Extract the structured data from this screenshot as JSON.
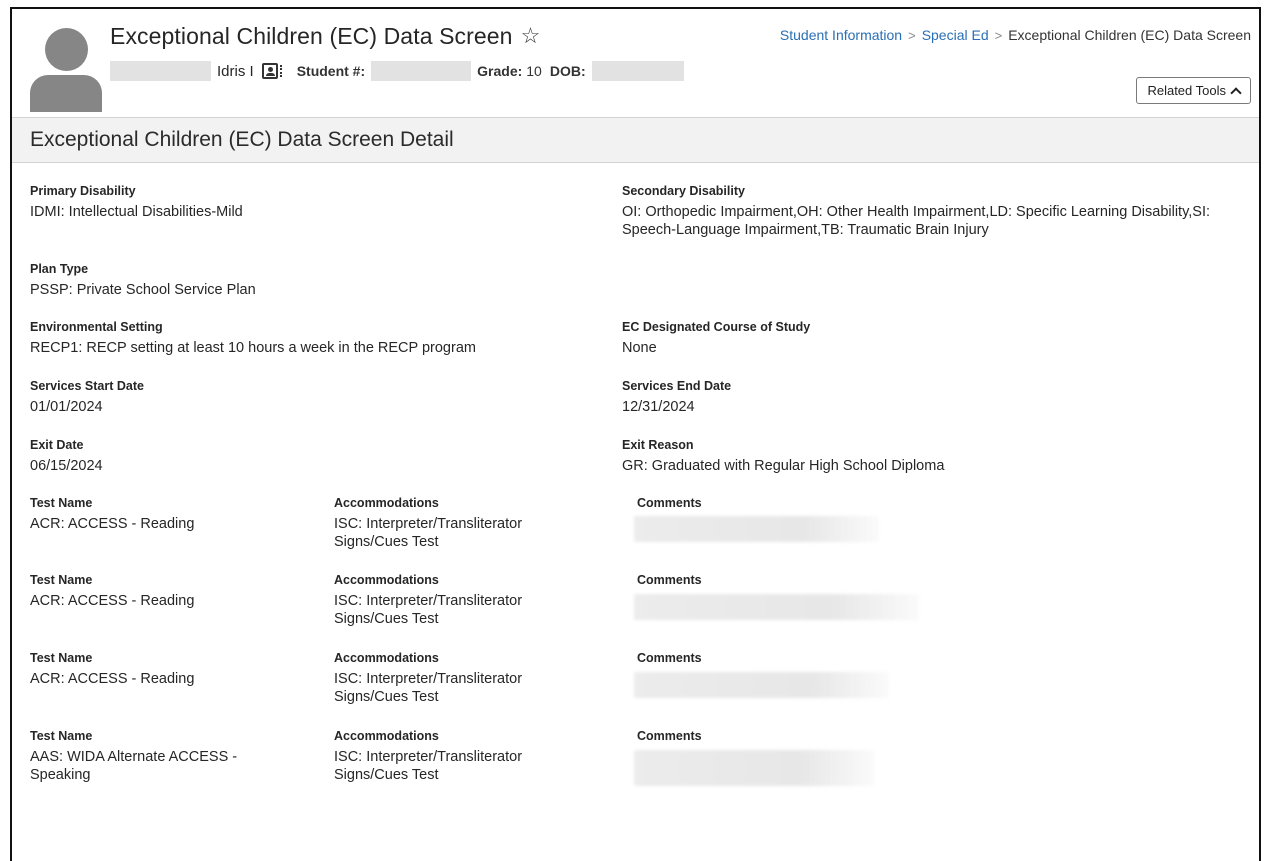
{
  "header": {
    "page_title": "Exceptional Children (EC) Data Screen",
    "student_name": "Idris I",
    "student_num_label": "Student #:",
    "grade_label": "Grade:",
    "grade_value": "10",
    "dob_label": "DOB:"
  },
  "breadcrumb": {
    "items": [
      "Student Information",
      "Special Ed",
      "Exceptional Children (EC) Data Screen"
    ],
    "separator": ">"
  },
  "related_tools": {
    "label": "Related Tools"
  },
  "detail": {
    "title": "Exceptional Children (EC) Data Screen Detail",
    "primary_disability": {
      "label": "Primary Disability",
      "value": "IDMI: Intellectual Disabilities-Mild"
    },
    "secondary_disability": {
      "label": "Secondary Disability",
      "value": "OI: Orthopedic Impairment,OH: Other Health Impairment,LD: Specific Learning Disability,SI: Speech-Language Impairment,TB: Traumatic Brain Injury"
    },
    "plan_type": {
      "label": "Plan Type",
      "value": "PSSP: Private School Service Plan"
    },
    "environmental_setting": {
      "label": "Environmental Setting",
      "value": "RECP1: RECP setting at least 10 hours a week in the RECP program"
    },
    "course_of_study": {
      "label": "EC Designated Course of Study",
      "value": "None"
    },
    "services_start": {
      "label": "Services Start Date",
      "value": "01/01/2024"
    },
    "services_end": {
      "label": "Services End Date",
      "value": "12/31/2024"
    },
    "exit_date": {
      "label": "Exit Date",
      "value": "06/15/2024"
    },
    "exit_reason": {
      "label": "Exit Reason",
      "value": "GR: Graduated with Regular High School Diploma"
    }
  },
  "tests": {
    "test_name_label": "Test Name",
    "accommodations_label": "Accommodations",
    "comments_label": "Comments",
    "rows": [
      {
        "test_name": "ACR: ACCESS - Reading",
        "accommodations": "ISC: Interpreter/Transliterator Signs/Cues Test"
      },
      {
        "test_name": "ACR: ACCESS - Reading",
        "accommodations": "ISC: Interpreter/Transliterator Signs/Cues Test"
      },
      {
        "test_name": "ACR: ACCESS - Reading",
        "accommodations": "ISC: Interpreter/Transliterator Signs/Cues Test"
      },
      {
        "test_name": "AAS: WIDA Alternate ACCESS - Speaking",
        "accommodations": "ISC: Interpreter/Transliterator Signs/Cues Test"
      }
    ]
  },
  "icons": {
    "star": "star-outline-icon",
    "contact": "contact-card-icon",
    "chevron": "chevron-up-icon",
    "avatar": "person-silhouette"
  },
  "colors": {
    "link": "#2a6fb5",
    "detail_bar_bg": "#f2f2f2",
    "avatar": "#868686"
  }
}
